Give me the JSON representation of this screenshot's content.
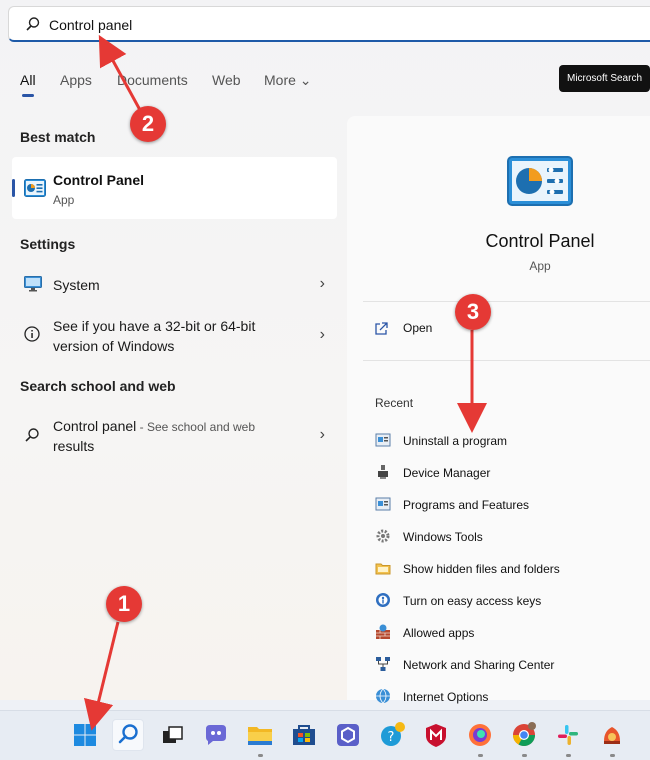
{
  "search": {
    "value": "Control panel"
  },
  "tabs": [
    "All",
    "Apps",
    "Documents",
    "Web",
    "More ⌄"
  ],
  "microsoft_search_label": "Microsoft Search",
  "best_match": {
    "heading": "Best match",
    "title": "Control Panel",
    "subtitle": "App"
  },
  "settings": {
    "heading": "Settings",
    "items": [
      {
        "label": "System"
      },
      {
        "label_line1": "See if you have a 32-bit or 64-bit",
        "label_line2": "version of Windows"
      }
    ]
  },
  "web": {
    "heading": "Search school and web",
    "query": "Control panel",
    "hint_line1": " - See school and web",
    "hint_line2": "results"
  },
  "preview": {
    "title": "Control Panel",
    "subtitle": "App",
    "open_label": "Open",
    "recent_heading": "Recent",
    "recent": [
      {
        "label": "Uninstall a program",
        "icon": "programs-icon"
      },
      {
        "label": "Device Manager",
        "icon": "device-manager-icon"
      },
      {
        "label": "Programs and Features",
        "icon": "programs-icon"
      },
      {
        "label": "Windows Tools",
        "icon": "windows-tools-icon"
      },
      {
        "label": "Show hidden files and folders",
        "icon": "folder-options-icon"
      },
      {
        "label": "Turn on easy access keys",
        "icon": "ease-of-access-icon"
      },
      {
        "label": "Allowed apps",
        "icon": "firewall-icon"
      },
      {
        "label": "Network and Sharing Center",
        "icon": "network-icon"
      },
      {
        "label": "Internet Options",
        "icon": "internet-options-icon"
      }
    ]
  },
  "annotations": [
    "1",
    "2",
    "3"
  ],
  "colors": {
    "accent": "#2a55a6",
    "annotation": "#e53935"
  }
}
